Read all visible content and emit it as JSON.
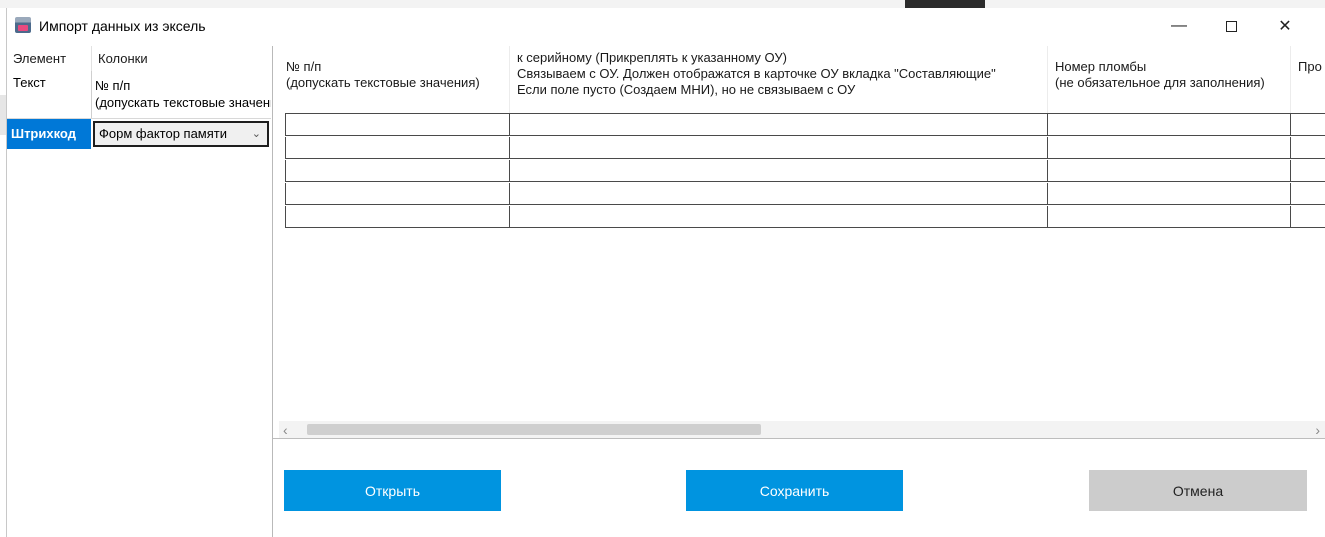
{
  "window": {
    "title": "Импорт данных из эксель",
    "controls": {
      "minimize": "—",
      "close": "✕"
    }
  },
  "left_grid": {
    "headers": [
      "Элемент",
      "Колонки"
    ],
    "rows": [
      {
        "element": "Текст",
        "column_line1": "№ п/п",
        "column_line2": "(допускать текстовые значения)"
      },
      {
        "element": "Штрихкод",
        "column_value": "Форм фактор памяти"
      }
    ]
  },
  "main_grid": {
    "columns": [
      {
        "lines": [
          "№ п/п",
          "(допускать текстовые значения)"
        ]
      },
      {
        "lines": [
          "к серийному  (Прикреплять к указанному ОУ)",
          "Связываем с ОУ. Должен отображатся в карточке ОУ вкладка \"Составляющие\"",
          "Если поле пусто (Создаем МНИ), но не связываем с ОУ"
        ]
      },
      {
        "lines": [
          "Номер пломбы",
          "(не обязательное для заполнения)"
        ]
      },
      {
        "lines": [
          "Про"
        ]
      }
    ],
    "empty_rows": 5,
    "scroll": {
      "left_arrow": "‹",
      "right_arrow": "›"
    }
  },
  "buttons": {
    "open": "Открыть",
    "save": "Сохранить",
    "cancel": "Отмена"
  },
  "colors": {
    "primary_button": "#0094e0",
    "selected_cell": "#0078d7",
    "cancel_button": "#cccccc"
  }
}
